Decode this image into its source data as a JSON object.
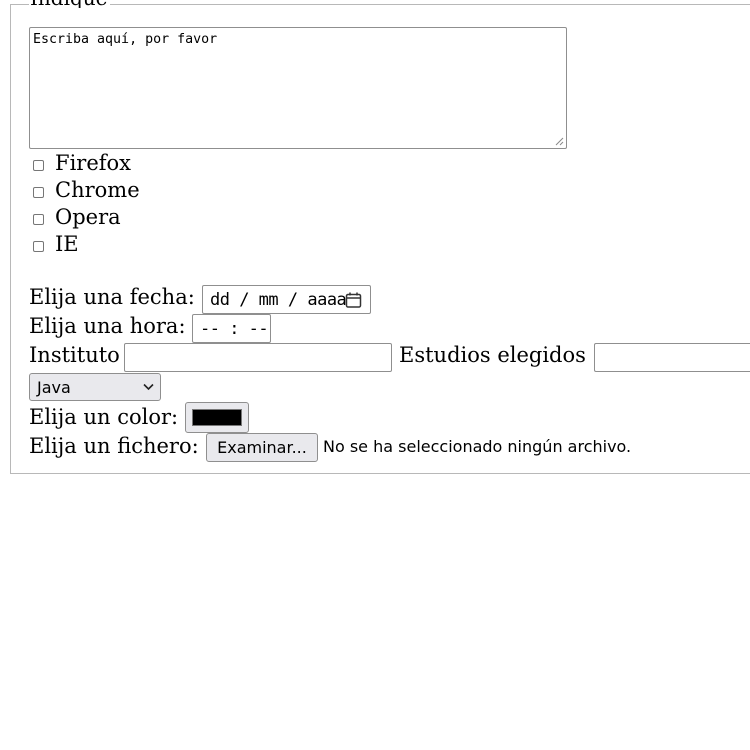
{
  "form": {
    "legend": "Indique",
    "textarea_value": "Escriba aquí, por favor",
    "browsers": [
      {
        "label": "Firefox",
        "checked": false
      },
      {
        "label": "Chrome",
        "checked": false
      },
      {
        "label": "Opera",
        "checked": false
      },
      {
        "label": "IE",
        "checked": false
      }
    ],
    "date": {
      "label": "Elija una fecha:",
      "placeholder": "dd / mm / aaaa"
    },
    "time": {
      "label": "Elija una hora:",
      "placeholder": "-- : --"
    },
    "instituto": {
      "label": "Instituto",
      "value": ""
    },
    "estudios": {
      "label": "Estudios elegidos",
      "value": ""
    },
    "select": {
      "selected": "Java"
    },
    "color": {
      "label": "Elija un color:",
      "value": "#000000"
    },
    "file": {
      "label": "Elija un fichero:",
      "button": "Examinar...",
      "status": "No se ha seleccionado ningún archivo."
    }
  }
}
